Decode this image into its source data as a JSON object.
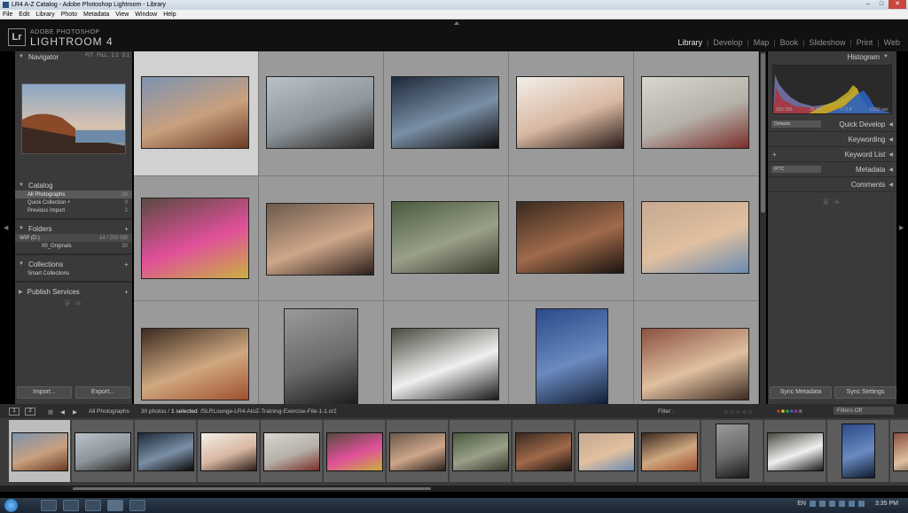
{
  "window": {
    "title": "LR4 A-Z Catalog - Adobe Photoshop Lightroom - Library",
    "controls": [
      "–",
      "□",
      "✕"
    ]
  },
  "menu": [
    "File",
    "Edit",
    "Library",
    "Photo",
    "Metadata",
    "View",
    "Window",
    "Help"
  ],
  "identity": {
    "badge": "Lr",
    "brand_small": "ADOBE PHOTOSHOP",
    "brand_big": "LIGHTROOM 4",
    "modules": [
      "Library",
      "Develop",
      "Map",
      "Book",
      "Slideshow",
      "Print",
      "Web"
    ],
    "active_module": "Library"
  },
  "left_panel": {
    "navigator": {
      "title": "Navigator",
      "options": [
        "FIT",
        "FILL",
        "1:1",
        "3:1"
      ]
    },
    "catalog": {
      "title": "Catalog",
      "rows": [
        {
          "label": "All Photographs",
          "count": "30"
        },
        {
          "label": "Quick Collection +",
          "count": "0"
        },
        {
          "label": "Previous Import",
          "count": "2"
        }
      ]
    },
    "folders": {
      "title": "Folders",
      "drive": {
        "label": "WIP (D:)",
        "size": "14 / 200 GB"
      },
      "rows": [
        {
          "label": "00_Originals",
          "count": "30"
        }
      ]
    },
    "collections": {
      "title": "Collections",
      "rows": [
        {
          "label": "Smart Collections"
        }
      ]
    },
    "publish": {
      "title": "Publish Services"
    },
    "import_label": "Import...",
    "export_label": "Export..."
  },
  "right_panel": {
    "histogram": {
      "title": "Histogram",
      "iso": "ISO 100",
      "focal": "24 mm",
      "aperture": "f / 2.8",
      "shutter": "1/250 sec"
    },
    "quick_develop": {
      "title": "Quick Develop",
      "preset": "Defaults"
    },
    "keywording": "Keywording",
    "keyword_list": "Keyword List",
    "metadata": {
      "title": "Metadata",
      "preset": "IPTC"
    },
    "comments": "Comments",
    "sync_metadata": "Sync Metadata",
    "sync_settings": "Sync Settings"
  },
  "filmstrip_bar": {
    "page1": "1",
    "page2": "2",
    "source": "All Photographs",
    "count": "30 photos /",
    "selected": "1 selected",
    "file": "/SLRLounge-LR4-AtoZ-Training-Exercise-File-1-1.cr2",
    "filter_label": "Filter :",
    "filters_off": "Filters Off"
  },
  "taskbar": {
    "lang": "EN",
    "time": "3:35 PM"
  },
  "colors": {
    "grid_bg": "#8e8e8e",
    "panel_bg": "#3a3a3a",
    "selected_cell": "#d1d1d1",
    "active_module": "#e8e8e8"
  }
}
